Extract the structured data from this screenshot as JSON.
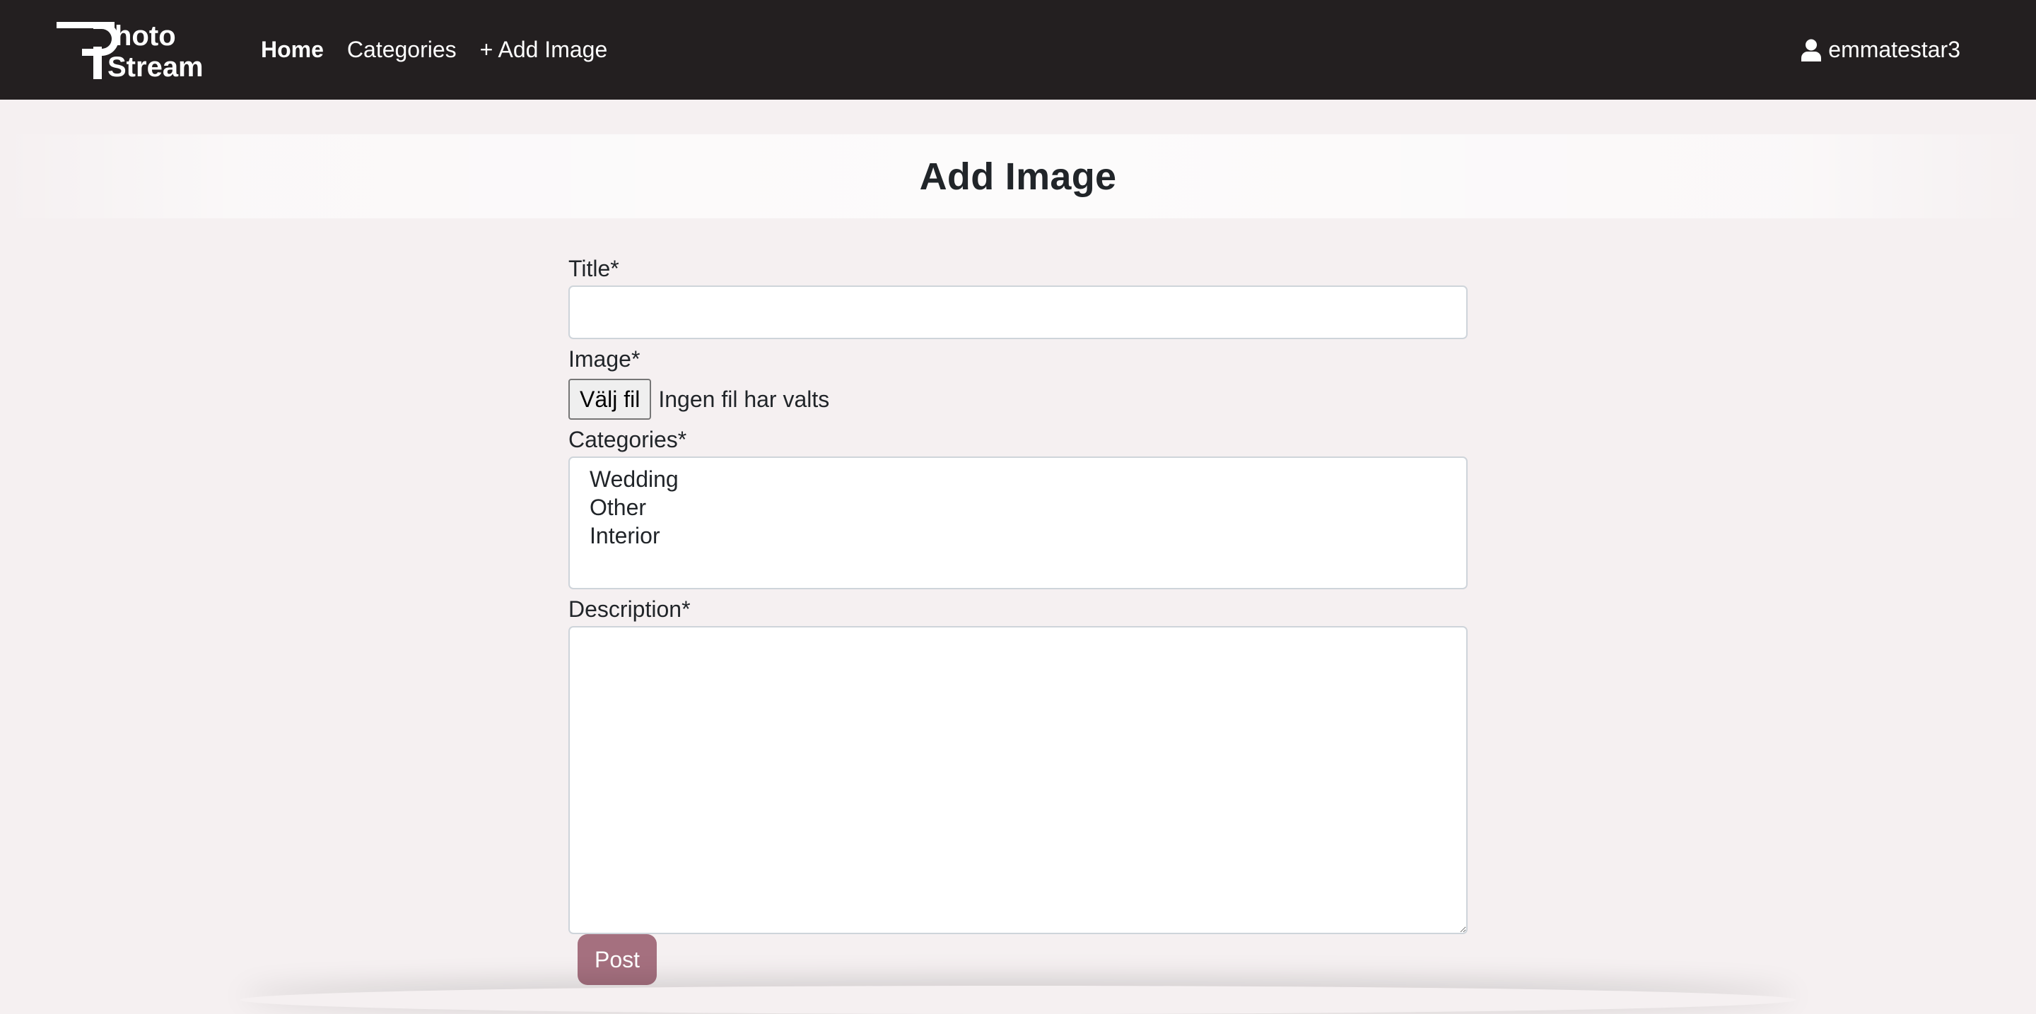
{
  "brand": {
    "logo_line1": "hoto",
    "logo_line2": "Stream"
  },
  "nav": {
    "items": [
      {
        "label": "Home",
        "active": true
      },
      {
        "label": "Categories",
        "active": false
      },
      {
        "label": "+ Add Image",
        "active": false
      }
    ],
    "user": {
      "icon": "user-icon",
      "username": "emmatestar3"
    }
  },
  "page": {
    "title": "Add Image"
  },
  "form": {
    "title_label": "Title*",
    "title_value": "",
    "image_label": "Image*",
    "file_button_label": "Välj fil",
    "file_status": "Ingen fil har valts",
    "categories_label": "Categories*",
    "categories_options": [
      "Wedding",
      "Other",
      "Interior"
    ],
    "description_label": "Description*",
    "description_value": "",
    "submit_label": "Post"
  },
  "colors": {
    "navbar_bg": "#231f20",
    "page_bg": "#f5f0f1",
    "button_accent": "#a5707f"
  }
}
